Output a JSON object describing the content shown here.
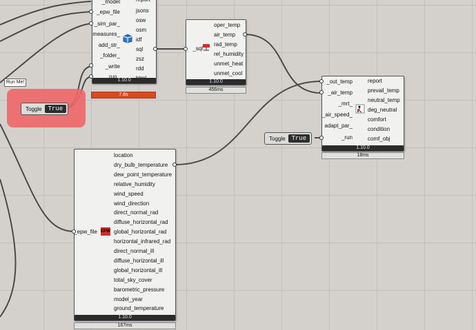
{
  "colors": {
    "canvas": "#d4d1cc",
    "panel": "#ee6668",
    "wire": "#4a4a4a",
    "timer_red": "#d84b1c"
  },
  "run_group": {
    "bubble": "Run Me!",
    "toggle_label": "Toggle",
    "toggle_value": "True"
  },
  "sim_component": {
    "inputs": [
      "_model",
      "_epw_file",
      "_sim_par_",
      "measures_",
      "add_str_",
      "_folder_",
      "_write",
      "run_"
    ],
    "outputs": [
      "report",
      "jsons",
      "osw",
      "osm",
      "idf",
      "sql",
      "zsz",
      "rdd",
      "html"
    ],
    "version": "1.10.0",
    "time": "7.6s",
    "icon": "cube-icon"
  },
  "sql_component": {
    "inputs": [
      "_sql"
    ],
    "outputs": [
      "oper_temp",
      "air_temp",
      "rad_temp",
      "rel_humidity",
      "unmet_heat",
      "unmet_cool"
    ],
    "version": "1.10.0",
    "time": "456ms",
    "icon": "thermometer-icon"
  },
  "comfort_component": {
    "inputs": [
      "_out_temp",
      "_air_temp",
      "_mrt_",
      "_air_speed_",
      "adapt_par_",
      "_run"
    ],
    "outputs": [
      "report",
      "prevail_temp",
      "neutral_temp",
      "deg_neutral",
      "comfort",
      "condition",
      "comf_obj"
    ],
    "version": "1.10.0",
    "time": "18ms",
    "icon": "person-icon"
  },
  "toggle2": {
    "label": "Toggle",
    "value": "True"
  },
  "epw_component": {
    "inputs": [
      "_epw_file"
    ],
    "outputs": [
      "location",
      "dry_bulb_temperature",
      "dew_point_temperature",
      "relative_humidity",
      "wind_speed",
      "wind_direction",
      "direct_normal_rad",
      "diffuse_horizontal_rad",
      "global_horizontal_rad",
      "horizontal_infrared_rad",
      "direct_normal_ill",
      "diffuse_horizontal_ill",
      "global_horizontal_ill",
      "total_sky_cover",
      "barometric_pressure",
      "model_year",
      "ground_temperature"
    ],
    "version": "1.10.0",
    "time": "167ms",
    "icon_text": "EPW"
  }
}
